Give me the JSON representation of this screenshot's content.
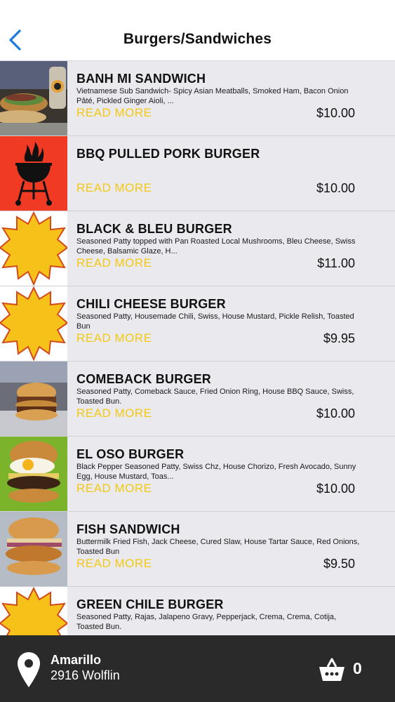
{
  "header": {
    "title": "Burgers/Sandwiches",
    "back_icon": "chevron-left-icon",
    "accent_color": "#1a7ae0"
  },
  "colors": {
    "read_more": "#f3c913",
    "row_background": "#e9e9ee",
    "bottom_bar": "#2a2a2a"
  },
  "menu": {
    "read_more_label": "READ MORE",
    "items": [
      {
        "name": "BANH MI SANDWICH",
        "description": "Vietnamese Sub Sandwich- Spicy Asian Meatballs, Smoked Ham, Bacon Onion Pâté, Pickled Ginger Aioli, ...",
        "price": "$10.00",
        "image": "banh-mi-photo"
      },
      {
        "name": "BBQ PULLED PORK BURGER",
        "description": "",
        "price": "$10.00",
        "image": "bbq-grill-icon"
      },
      {
        "name": "BLACK & BLEU BURGER",
        "description": "Seasoned Patty topped with Pan Roasted Local Mushrooms, Bleu Cheese, Swiss Cheese, Balsamic Glaze, H...",
        "price": "$11.00",
        "image": "burger-special-logo"
      },
      {
        "name": "CHILI CHEESE BURGER",
        "description": "Seasoned Patty, Housemade Chili, Swiss, House Mustard, Pickle Relish, Toasted Bun",
        "price": "$9.95",
        "image": "burger-special-logo"
      },
      {
        "name": "COMEBACK BURGER",
        "description": "Seasoned Patty, Comeback Sauce, Fried Onion Ring, House BBQ Sauce, Swiss, Toasted Bun.",
        "price": "$10.00",
        "image": "comeback-burger-photo"
      },
      {
        "name": "EL OSO BURGER",
        "description": "Black Pepper Seasoned Patty, Swiss Chz, House Chorizo, Fresh Avocado, Sunny Egg, House Mustard, Toas...",
        "price": "$10.00",
        "image": "el-oso-burger-photo"
      },
      {
        "name": "FISH SANDWICH",
        "description": "Buttermilk Fried Fish, Jack Cheese, Cured Slaw, House Tartar Sauce, Red Onions, Toasted Bun",
        "price": "$9.50",
        "image": "fish-sandwich-photo"
      },
      {
        "name": "GREEN CHILE BURGER",
        "description": "Seasoned Patty, Rajas, Jalapeno Gravy, Pepperjack, Crema, Crema, Cotija, Toasted Bun.",
        "price": "",
        "image": "burger-special-logo"
      }
    ]
  },
  "footer": {
    "location_name": "Amarillo",
    "location_address": "2916 Wolflin",
    "location_icon": "map-pin-icon",
    "cart_icon": "basket-icon",
    "cart_count": "0"
  }
}
